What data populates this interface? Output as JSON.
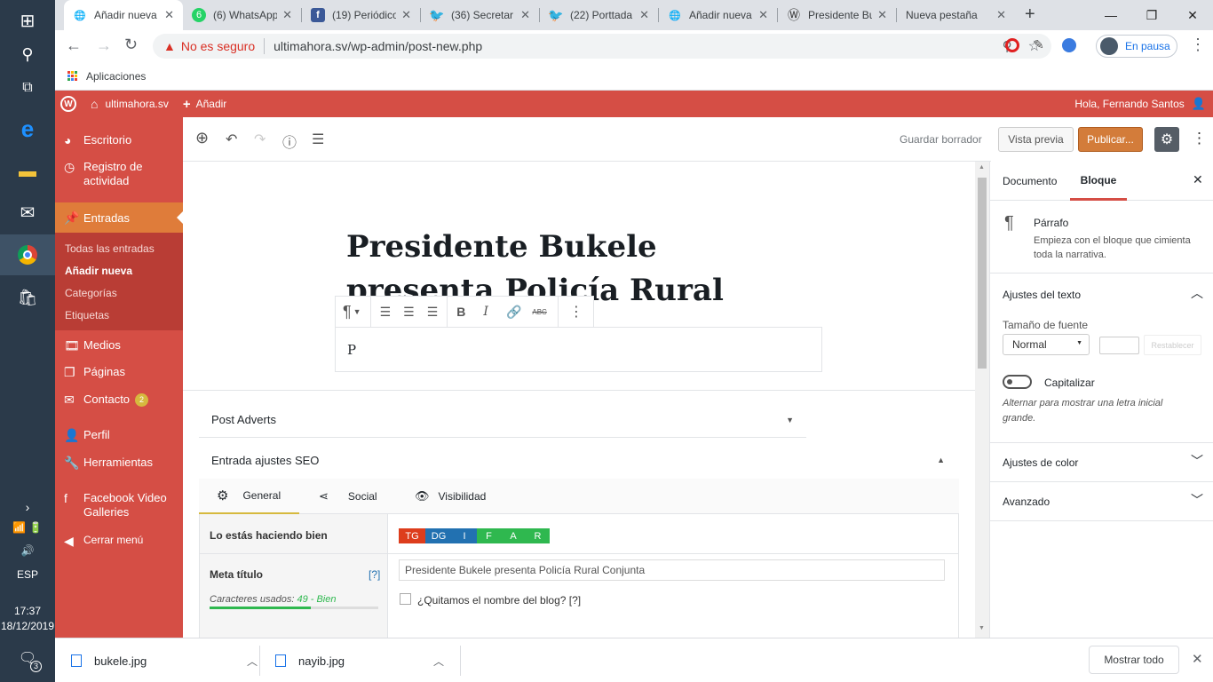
{
  "taskbar": {
    "lang": "ESP",
    "time": "17:37",
    "date": "18/12/2019",
    "notif_count": "3"
  },
  "tabs": [
    {
      "title": "Añadir nueva",
      "icon": "globe-icon"
    },
    {
      "title": "(6) WhatsApp",
      "icon": "whatsapp-icon",
      "badge": "6"
    },
    {
      "title": "(19) Periódico",
      "icon": "facebook-icon"
    },
    {
      "title": "(36) Secretar",
      "icon": "twitter-icon"
    },
    {
      "title": "(22) Porttada",
      "icon": "twitter-icon"
    },
    {
      "title": "Añadir nueva",
      "icon": "globe-icon"
    },
    {
      "title": "Presidente Bu",
      "icon": "wordpress-icon"
    },
    {
      "title": "Nueva pestaña",
      "icon": ""
    }
  ],
  "address": {
    "security": "No es seguro",
    "url": "ultimahora.sv/wp-admin/post-new.php",
    "profile": "En pausa"
  },
  "bookmarks": {
    "apps": "Aplicaciones"
  },
  "adminbar": {
    "site": "ultimahora.sv",
    "add": "Añadir",
    "greeting": "Hola, Fernando Santos"
  },
  "menu": {
    "escritorio": "Escritorio",
    "registro": "Registro de actividad",
    "entradas": "Entradas",
    "sub": [
      "Todas las entradas",
      "Añadir nueva",
      "Categorías",
      "Etiquetas"
    ],
    "medios": "Medios",
    "paginas": "Páginas",
    "contacto": "Contacto",
    "contacto_badge": "2",
    "perfil": "Perfil",
    "herramientas": "Herramientas",
    "fbvideo": "Facebook Video Galleries",
    "cerrar": "Cerrar menú"
  },
  "editor": {
    "save_draft": "Guardar borrador",
    "preview": "Vista previa",
    "publish": "Publicar...",
    "title": "Presidente Bukele presenta Policía Rural Conjunta",
    "paragraph_text": "P"
  },
  "metabox": {
    "post_adverts": "Post Adverts",
    "seo_title": "Entrada ajustes SEO",
    "tabs": [
      "General",
      "Social",
      "Visibilidad"
    ],
    "doing_well": "Lo estás haciendo bien",
    "badges": [
      {
        "label": "TG",
        "color": "#dd3d1c"
      },
      {
        "label": "DG",
        "color": "#2271b1"
      },
      {
        "label": "I",
        "color": "#2271b1"
      },
      {
        "label": "F",
        "color": "#2fb84f"
      },
      {
        "label": "A",
        "color": "#2fb84f"
      },
      {
        "label": "R",
        "color": "#2fb84f"
      }
    ],
    "meta_title_label": "Meta título",
    "help": "[?]",
    "chars_used_label": "Caracteres usados:",
    "chars_used_value": "49 - Bien",
    "meta_title_value": "Presidente Bukele presenta Policía Rural Conjunta",
    "remove_blog_name": "¿Quitamos el nombre del blog? [?]",
    "meta_progress": 0.6
  },
  "sidebar": {
    "tab_document": "Documento",
    "tab_block": "Bloque",
    "block_name": "Párrafo",
    "block_desc": "Empieza con el bloque que cimienta toda la narrativa.",
    "text_settings": "Ajustes del texto",
    "font_size_label": "Tamaño de fuente",
    "font_size_value": "Normal",
    "reset": "Restablecer",
    "dropcap": "Capitalizar",
    "dropcap_help": "Alternar para mostrar una letra inicial grande.",
    "color_settings": "Ajustes de color",
    "advanced": "Avanzado"
  },
  "downloads": {
    "items": [
      "bukele.jpg",
      "nayib.jpg"
    ],
    "show_all": "Mostrar todo"
  }
}
